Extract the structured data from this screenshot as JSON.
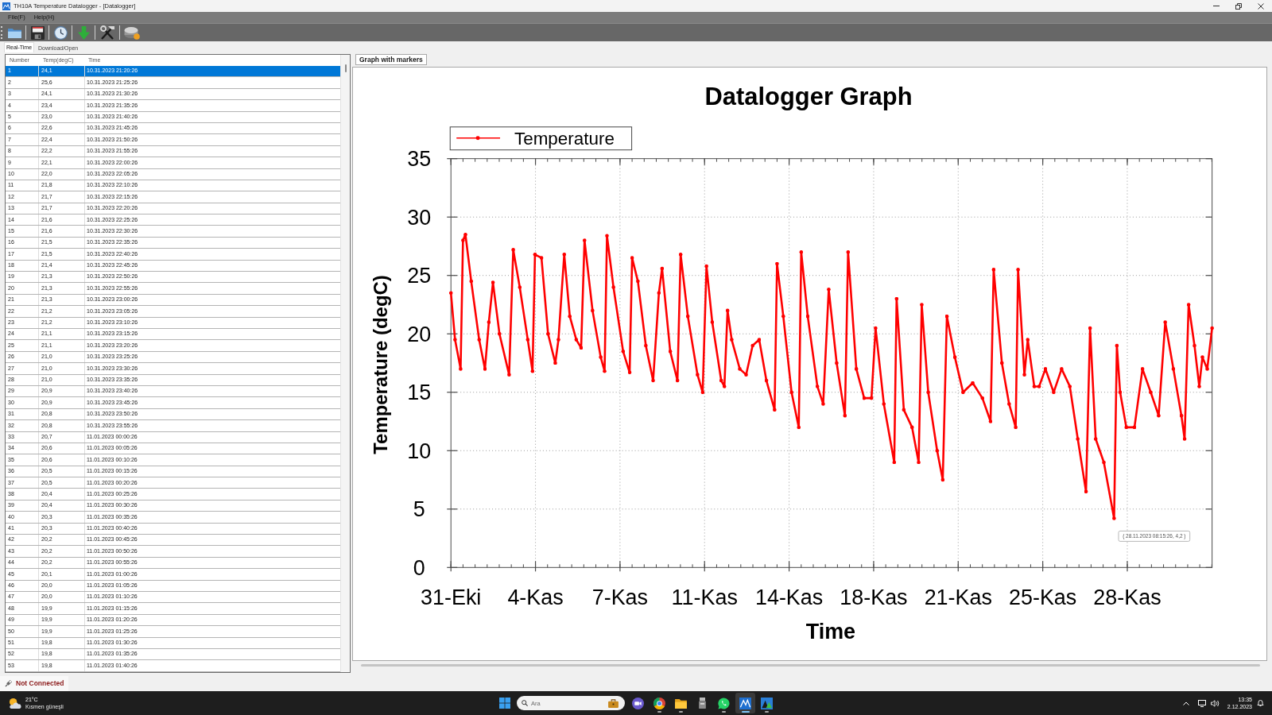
{
  "window": {
    "title": "TH10A Temperature Datalogger - [Datalogger]"
  },
  "menu": [
    "File(F)",
    "Help(H)"
  ],
  "tabs": [
    {
      "label": "Real-Time",
      "selected": true
    },
    {
      "label": "Download/Open",
      "selected": false
    }
  ],
  "table": {
    "columns": [
      "Number",
      "Temp(degC)",
      "Time"
    ],
    "rows": [
      {
        "cells": [
          "1",
          "24,1",
          "10.31.2023 21:20:26"
        ],
        "selected": true
      },
      {
        "cells": [
          "2",
          "25,6",
          "10.31.2023 21:25:26"
        ],
        "selected": false
      },
      {
        "cells": [
          "3",
          "24,1",
          "10.31.2023 21:30:26"
        ],
        "selected": false
      },
      {
        "cells": [
          "4",
          "23,4",
          "10.31.2023 21:35:26"
        ],
        "selected": false
      },
      {
        "cells": [
          "5",
          "23,0",
          "10.31.2023 21:40:26"
        ],
        "selected": false
      },
      {
        "cells": [
          "6",
          "22,6",
          "10.31.2023 21:45:26"
        ],
        "selected": false
      },
      {
        "cells": [
          "7",
          "22,4",
          "10.31.2023 21:50:26"
        ],
        "selected": false
      },
      {
        "cells": [
          "8",
          "22,2",
          "10.31.2023 21:55:26"
        ],
        "selected": false
      },
      {
        "cells": [
          "9",
          "22,1",
          "10.31.2023 22:00:26"
        ],
        "selected": false
      },
      {
        "cells": [
          "10",
          "22,0",
          "10.31.2023 22:05:26"
        ],
        "selected": false
      },
      {
        "cells": [
          "11",
          "21,8",
          "10.31.2023 22:10:26"
        ],
        "selected": false
      },
      {
        "cells": [
          "12",
          "21,7",
          "10.31.2023 22:15:26"
        ],
        "selected": false
      },
      {
        "cells": [
          "13",
          "21,7",
          "10.31.2023 22:20:26"
        ],
        "selected": false
      },
      {
        "cells": [
          "14",
          "21,6",
          "10.31.2023 22:25:26"
        ],
        "selected": false
      },
      {
        "cells": [
          "15",
          "21,6",
          "10.31.2023 22:30:26"
        ],
        "selected": false
      },
      {
        "cells": [
          "16",
          "21,5",
          "10.31.2023 22:35:26"
        ],
        "selected": false
      },
      {
        "cells": [
          "17",
          "21,5",
          "10.31.2023 22:40:26"
        ],
        "selected": false
      },
      {
        "cells": [
          "18",
          "21,4",
          "10.31.2023 22:45:26"
        ],
        "selected": false
      },
      {
        "cells": [
          "19",
          "21,3",
          "10.31.2023 22:50:26"
        ],
        "selected": false
      },
      {
        "cells": [
          "20",
          "21,3",
          "10.31.2023 22:55:26"
        ],
        "selected": false
      },
      {
        "cells": [
          "21",
          "21,3",
          "10.31.2023 23:00:26"
        ],
        "selected": false
      },
      {
        "cells": [
          "22",
          "21,2",
          "10.31.2023 23:05:26"
        ],
        "selected": false
      },
      {
        "cells": [
          "23",
          "21,2",
          "10.31.2023 23:10:26"
        ],
        "selected": false
      },
      {
        "cells": [
          "24",
          "21,1",
          "10.31.2023 23:15:26"
        ],
        "selected": false
      },
      {
        "cells": [
          "25",
          "21,1",
          "10.31.2023 23:20:26"
        ],
        "selected": false
      },
      {
        "cells": [
          "26",
          "21,0",
          "10.31.2023 23:25:26"
        ],
        "selected": false
      },
      {
        "cells": [
          "27",
          "21,0",
          "10.31.2023 23:30:26"
        ],
        "selected": false
      },
      {
        "cells": [
          "28",
          "21,0",
          "10.31.2023 23:35:26"
        ],
        "selected": false
      },
      {
        "cells": [
          "29",
          "20,9",
          "10.31.2023 23:40:26"
        ],
        "selected": false
      },
      {
        "cells": [
          "30",
          "20,9",
          "10.31.2023 23:45:26"
        ],
        "selected": false
      },
      {
        "cells": [
          "31",
          "20,8",
          "10.31.2023 23:50:26"
        ],
        "selected": false
      },
      {
        "cells": [
          "32",
          "20,8",
          "10.31.2023 23:55:26"
        ],
        "selected": false
      },
      {
        "cells": [
          "33",
          "20,7",
          "11.01.2023 00:00:26"
        ],
        "selected": false
      },
      {
        "cells": [
          "34",
          "20,6",
          "11.01.2023 00:05:26"
        ],
        "selected": false
      },
      {
        "cells": [
          "35",
          "20,6",
          "11.01.2023 00:10:26"
        ],
        "selected": false
      },
      {
        "cells": [
          "36",
          "20,5",
          "11.01.2023 00:15:26"
        ],
        "selected": false
      },
      {
        "cells": [
          "37",
          "20,5",
          "11.01.2023 00:20:26"
        ],
        "selected": false
      },
      {
        "cells": [
          "38",
          "20,4",
          "11.01.2023 00:25:26"
        ],
        "selected": false
      },
      {
        "cells": [
          "39",
          "20,4",
          "11.01.2023 00:30:26"
        ],
        "selected": false
      },
      {
        "cells": [
          "40",
          "20,3",
          "11.01.2023 00:35:26"
        ],
        "selected": false
      },
      {
        "cells": [
          "41",
          "20,3",
          "11.01.2023 00:40:26"
        ],
        "selected": false
      },
      {
        "cells": [
          "42",
          "20,2",
          "11.01.2023 00:45:26"
        ],
        "selected": false
      },
      {
        "cells": [
          "43",
          "20,2",
          "11.01.2023 00:50:26"
        ],
        "selected": false
      },
      {
        "cells": [
          "44",
          "20,2",
          "11.01.2023 00:55:26"
        ],
        "selected": false
      },
      {
        "cells": [
          "45",
          "20,1",
          "11.01.2023 01:00:26"
        ],
        "selected": false
      },
      {
        "cells": [
          "46",
          "20,0",
          "11.01.2023 01:05:26"
        ],
        "selected": false
      },
      {
        "cells": [
          "47",
          "20,0",
          "11.01.2023 01:10:26"
        ],
        "selected": false
      },
      {
        "cells": [
          "48",
          "19,9",
          "11.01.2023 01:15:26"
        ],
        "selected": false
      },
      {
        "cells": [
          "49",
          "19,9",
          "11.01.2023 01:20:26"
        ],
        "selected": false
      },
      {
        "cells": [
          "50",
          "19,9",
          "11.01.2023 01:25:26"
        ],
        "selected": false
      },
      {
        "cells": [
          "51",
          "19,8",
          "11.01.2023 01:30:26"
        ],
        "selected": false
      },
      {
        "cells": [
          "52",
          "19,8",
          "11.01.2023 01:35:26"
        ],
        "selected": false
      },
      {
        "cells": [
          "53",
          "19,8",
          "11.01.2023 01:40:26"
        ],
        "selected": false
      }
    ]
  },
  "graph": {
    "tabs": [
      {
        "label": "Graph with markers",
        "selected": true
      }
    ],
    "chart_data": {
      "type": "line",
      "title": "Datalogger Graph",
      "xlabel": "Time",
      "ylabel": "Temperature (degC)",
      "x": [
        "2023-10-31T21:20",
        "2023-11-01T01:25",
        "2023-11-01T06:55",
        "2023-11-01T09:20",
        "2023-11-01T11:45",
        "2023-11-01T17:30",
        "2023-11-02T01:25",
        "2023-11-02T07:10",
        "2023-11-02T11:00",
        "2023-11-02T15:05",
        "2023-11-02T21:35",
        "2023-11-03T07:10",
        "2023-11-03T11:15",
        "2023-11-03T17:45",
        "2023-11-04T01:40",
        "2023-11-04T06:25",
        "2023-11-04T08:50",
        "2023-11-04T15:20",
        "2023-11-04T21:50",
        "2023-11-05T05:00",
        "2023-11-05T08:10",
        "2023-11-05T13:55",
        "2023-11-05T19:25",
        "2023-11-06T01:55",
        "2023-11-06T06:40",
        "2023-11-06T10:05",
        "2023-11-06T18:00",
        "2023-11-07T02:10",
        "2023-11-07T06:00",
        "2023-11-07T08:20",
        "2023-11-07T14:50",
        "2023-11-08T00:25",
        "2023-11-08T06:55",
        "2023-11-08T09:20",
        "2023-11-08T15:05",
        "2023-11-08T23:00",
        "2023-11-09T06:15",
        "2023-11-09T12:00",
        "2023-11-09T15:05",
        "2023-11-09T23:15",
        "2023-11-10T06:25",
        "2023-11-10T09:35",
        "2023-11-10T16:45",
        "2023-11-11T02:20",
        "2023-11-11T07:25",
        "2023-11-11T11:15",
        "2023-11-11T17:00",
        "2023-11-12T01:55",
        "2023-11-12T05:00",
        "2023-11-12T08:10",
        "2023-11-12T12:15",
        "2023-11-12T20:20",
        "2023-11-13T02:35",
        "2023-11-13T09:05",
        "2023-11-13T15:35",
        "2023-11-13T22:45",
        "2023-11-14T06:55",
        "2023-11-14T09:20",
        "2023-11-14T15:35",
        "2023-11-14T23:45",
        "2023-11-15T06:55",
        "2023-11-15T09:20",
        "2023-11-15T15:50",
        "2023-11-16T01:25",
        "2023-11-16T07:10",
        "2023-11-16T12:40",
        "2023-11-16T20:35",
        "2023-11-17T04:45",
        "2023-11-17T07:55",
        "2023-11-17T16:05",
        "2023-11-17T23:55",
        "2023-11-18T07:10",
        "2023-11-18T11:15",
        "2023-11-18T19:25",
        "2023-11-19T05:45",
        "2023-11-19T08:10",
        "2023-11-19T15:20",
        "2023-11-19T23:30",
        "2023-11-20T06:00",
        "2023-11-20T09:05",
        "2023-11-20T15:35",
        "2023-11-21T00:25",
        "2023-11-21T06:00",
        "2023-11-21T10:05",
        "2023-11-21T18:00",
        "2023-11-22T02:10",
        "2023-11-22T11:45",
        "2023-11-22T21:20",
        "2023-11-23T05:30",
        "2023-11-23T08:35",
        "2023-11-23T16:45",
        "2023-11-23T23:55",
        "2023-11-24T06:25",
        "2023-11-24T08:50",
        "2023-11-24T15:05",
        "2023-11-24T18:25",
        "2023-11-25T00:55",
        "2023-11-25T05:45",
        "2023-11-25T12:00",
        "2023-11-25T20:10",
        "2023-11-26T04:05",
        "2023-11-26T12:15",
        "2023-11-26T20:10",
        "2023-11-27T04:20",
        "2023-11-27T08:20",
        "2023-11-27T13:55",
        "2023-11-27T22:05",
        "2023-11-28T08:15",
        "2023-11-28T11:00",
        "2023-11-28T14:10",
        "2023-11-28T20:20",
        "2023-11-29T04:30",
        "2023-11-29T12:25",
        "2023-11-29T20:35",
        "2023-11-30T04:30",
        "2023-11-30T11:00",
        "2023-11-30T19:10",
        "2023-12-01T03:05",
        "2023-12-01T06:15",
        "2023-12-01T10:15",
        "2023-12-01T16:05",
        "2023-12-01T20:50",
        "2023-12-02T00:00",
        "2023-12-02T04:45",
        "2023-12-02T09:35"
      ],
      "series": [
        {
          "name": "Temperature",
          "color": "#ff0000",
          "values": [
            23.5,
            19.5,
            17,
            28,
            28.5,
            24.5,
            19.5,
            17,
            21,
            24.4,
            20,
            16.5,
            27.2,
            24,
            19.5,
            16.8,
            26.8,
            26.5,
            20,
            17.5,
            19.5,
            26.8,
            21.5,
            19.5,
            18.8,
            28,
            22,
            18,
            16.8,
            28.4,
            24,
            18.5,
            16.7,
            26.5,
            24.5,
            19,
            16,
            23.5,
            25.6,
            18.5,
            16,
            26.8,
            21.5,
            16.5,
            15,
            25.8,
            21,
            16,
            15.5,
            22,
            19.5,
            17,
            16.5,
            19,
            19.5,
            16,
            13.5,
            26,
            21.5,
            15,
            12,
            27,
            21.5,
            15.5,
            14,
            23.8,
            17.5,
            13,
            27,
            17,
            14.5,
            14.5,
            20.5,
            14,
            9,
            23,
            13.5,
            12,
            9,
            22.5,
            15,
            10,
            7.5,
            21.5,
            18,
            15,
            15.8,
            14.5,
            12.5,
            25.5,
            17.5,
            14,
            12,
            25.5,
            16.5,
            19.5,
            15.5,
            15.5,
            17,
            15,
            17,
            15.5,
            11,
            6.5,
            20.5,
            11,
            9,
            4.2,
            19,
            15,
            12,
            12,
            17,
            15,
            13,
            21,
            17,
            13,
            11,
            22.5,
            19,
            15.5,
            18,
            17,
            20.5
          ]
        }
      ],
      "xlim": [
        "2023-10-31T21:20",
        "2023-12-02T09:35"
      ],
      "ylim": [
        0,
        35
      ],
      "xticks": [
        {
          "value": "2023-10-31T21:20",
          "label": "31-Eki"
        },
        {
          "value": "2023-11-04T09:20",
          "label": "4-Kas"
        },
        {
          "value": "2023-11-07T21:20",
          "label": "7-Kas"
        },
        {
          "value": "2023-11-11T09:20",
          "label": "11-Kas"
        },
        {
          "value": "2023-11-14T21:20",
          "label": "14-Kas"
        },
        {
          "value": "2023-11-18T09:20",
          "label": "18-Kas"
        },
        {
          "value": "2023-11-21T21:20",
          "label": "21-Kas"
        },
        {
          "value": "2023-11-25T09:20",
          "label": "25-Kas"
        },
        {
          "value": "2023-11-28T21:20",
          "label": "28-Kas"
        }
      ],
      "yticks": [
        0,
        5,
        10,
        15,
        20,
        25,
        30,
        35
      ],
      "grid": true,
      "annotations": [
        "( 28.11.2023 08:15:26, 4,2 )"
      ]
    }
  },
  "status_bar": {
    "connection": "Not Connected"
  },
  "taskbar": {
    "weather": {
      "temperature": "21°C",
      "condition": "Kısmen güneşli"
    },
    "search": {
      "placeholder": "Ara"
    },
    "apps": [
      {
        "kind": "camera",
        "running": false,
        "selected": false
      },
      {
        "kind": "browser",
        "running": true,
        "selected": false
      },
      {
        "kind": "folder",
        "running": true,
        "selected": false
      },
      {
        "kind": "device",
        "running": false,
        "selected": false
      },
      {
        "kind": "chat",
        "running": true,
        "selected": false
      },
      {
        "kind": "logger",
        "running": true,
        "selected": true
      },
      {
        "kind": "plotter",
        "running": true,
        "selected": false
      }
    ],
    "clock": {
      "time": "13:35",
      "date": "2.12.2023"
    }
  }
}
